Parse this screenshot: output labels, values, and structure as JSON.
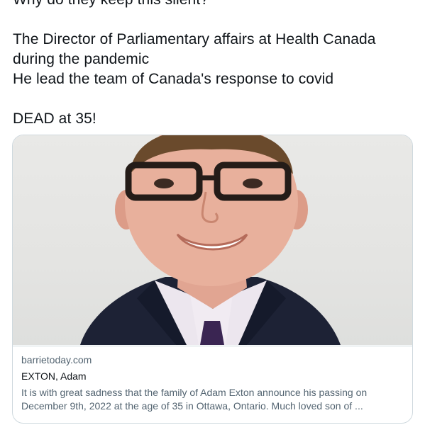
{
  "tweet": {
    "lines": [
      "Why do they keep this silent?",
      "The Director of Parliamentary affairs at Health Canada",
      "during the pandemic",
      "He lead the team of Canada's response to covid",
      "DEAD at 35!"
    ]
  },
  "card": {
    "domain": "barrietoday.com",
    "title": "EXTON, Adam",
    "description": "It is with great sadness that the family of Adam Exton announce his passing on December 9th, 2022 at the age of 35 in Ottawa, Ontario. Much loved son of ..."
  },
  "colors": {
    "text": "#0f1419",
    "secondary_text": "#536471",
    "border": "#cfd9de"
  }
}
